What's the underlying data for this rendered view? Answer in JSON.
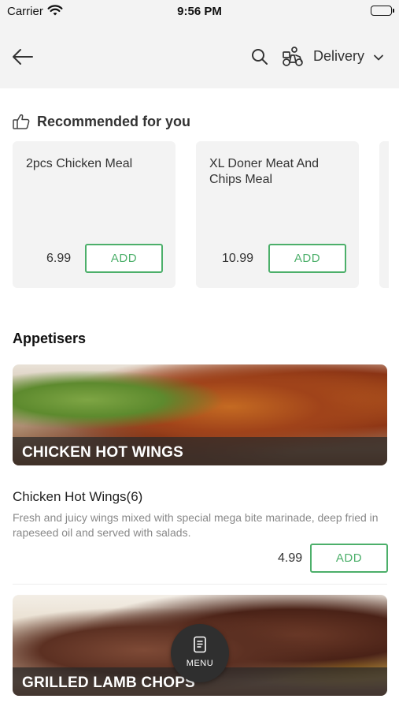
{
  "status_bar": {
    "carrier": "Carrier",
    "time": "9:56 PM"
  },
  "nav": {
    "delivery_label": "Delivery"
  },
  "recommended": {
    "title": "Recommended for you",
    "items": [
      {
        "name": "2pcs Chicken Meal",
        "price": "6.99",
        "add_label": "ADD"
      },
      {
        "name": "XL Doner Meat And Chips Meal",
        "price": "10.99",
        "add_label": "ADD"
      }
    ]
  },
  "section": {
    "title": "Appetisers",
    "hero_label": "CHICKEN HOT WINGS",
    "item": {
      "name": "Chicken Hot Wings(6)",
      "description": "Fresh and juicy wings mixed with special mega bite marinade, deep fried in rapeseed oil and served with salads.",
      "price": "4.99",
      "add_label": "ADD"
    },
    "next_hero_label": "GRILLED LAMB CHOPS"
  },
  "menu_button": {
    "label": "MENU"
  },
  "colors": {
    "accent_green": "#4caf6a",
    "header_bg": "#f3f3f3",
    "fab_bg": "#2f2f2f"
  }
}
